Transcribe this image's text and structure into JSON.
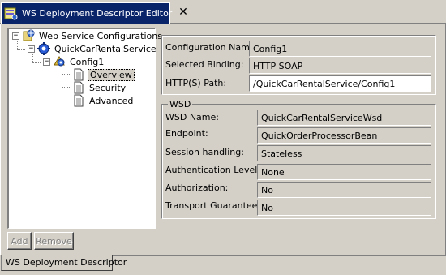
{
  "editor_tab": {
    "title": "WS Deployment Descriptor Editor",
    "close_glyph": "✕",
    "icon": "ws-editor-icon"
  },
  "tree": {
    "root": {
      "label": "Web Service Configurations",
      "icon": "web-services-icon",
      "expander": "−"
    },
    "service": {
      "label": "QuickCarRentalService",
      "icon": "gear-icon",
      "expander": "−"
    },
    "config": {
      "label": "Config1",
      "icon": "config-icon",
      "expander": "−"
    },
    "pages": [
      {
        "label": "Overview",
        "icon": "page-icon",
        "selected": true
      },
      {
        "label": "Security",
        "icon": "page-icon",
        "selected": false
      },
      {
        "label": "Advanced",
        "icon": "page-icon",
        "selected": false
      }
    ]
  },
  "buttons": {
    "add": "Add",
    "remove": "Remove"
  },
  "config_panel": {
    "configuration_name_label": "Configuration Name:",
    "configuration_name_value": "Config1",
    "selected_binding_label": "Selected Binding:",
    "selected_binding_value": "HTTP SOAP",
    "http_path_label": "HTTP(S) Path:",
    "http_path_value": "/QuickCarRentalService/Config1"
  },
  "wsd_panel": {
    "legend": "WSD",
    "wsd_name_label": "WSD Name:",
    "wsd_name_value": "QuickCarRentalServiceWsd",
    "endpoint_label": "Endpoint:",
    "endpoint_value": "QuickOrderProcessorBean",
    "session_label": "Session handling:",
    "session_value": "Stateless",
    "auth_level_label": "Authentication Level:",
    "auth_level_value": "None",
    "authorization_label": "Authorization:",
    "authorization_value": "No",
    "transport_label": "Transport Guarantee:",
    "transport_value": "No"
  },
  "page_tab": {
    "label": "WS Deployment Descriptor"
  },
  "colors": {
    "active_tab": "#0a246a",
    "background": "#d4d0c8",
    "field_white": "#ffffff"
  }
}
